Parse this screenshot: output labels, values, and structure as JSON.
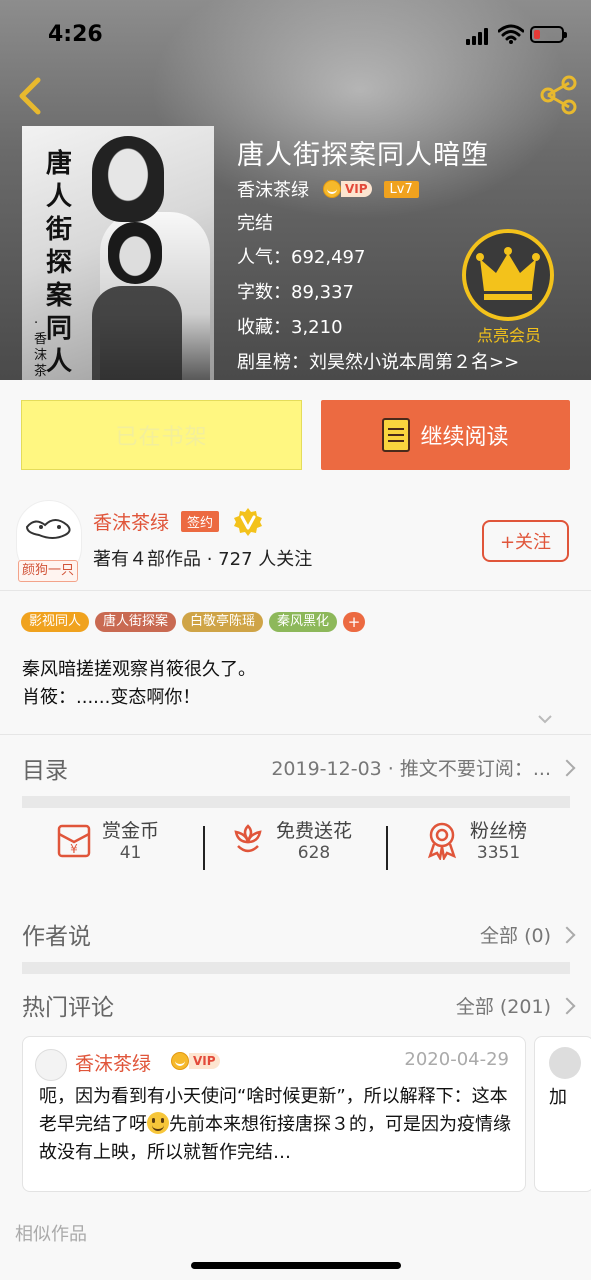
{
  "status_bar": {
    "time": "4:26"
  },
  "book": {
    "title": "唐人街探案同人暗堕",
    "author": "香沫茶绿",
    "vip": "VIP",
    "level": "Lv7",
    "status": "完结",
    "popularity": "人气：692,497",
    "words": "字数：89,337",
    "favorites": "收藏：3,210",
    "rank": "剧星榜：刘昊然小说本周第２名>>",
    "cover_title": "唐人街探案同人暗堕",
    "cover_author": "·香沫茶绿"
  },
  "member": {
    "label": "点亮会员"
  },
  "actions": {
    "shelf_label": "已在书架",
    "read_label": "继续阅读"
  },
  "author_card": {
    "name": "香沫茶绿",
    "sign_badge": "签约",
    "avatar_tag": "颜狗一只",
    "meta": "著有４部作品 · 727 人关注",
    "follow_label": "+关注"
  },
  "tags": [
    {
      "label": "影视同人",
      "color": "#f0a21e"
    },
    {
      "label": "唐人街探案",
      "color": "#c96a52"
    },
    {
      "label": "白敬亭陈瑶",
      "color": "#cfa447"
    },
    {
      "label": "秦风黑化",
      "color": "#8db85a"
    }
  ],
  "tag_more": "+",
  "summary": {
    "line1": "秦风暗搓搓观察肖筱很久了。",
    "line2": "肖筱：......变态啊你！"
  },
  "catalog": {
    "title": "目录",
    "right": "2019-12-03 · 推文不要订阅：..."
  },
  "stats": [
    {
      "label": "赏金币",
      "value": "41",
      "icon": "reward-coin-icon"
    },
    {
      "label": "免费送花",
      "value": "628",
      "icon": "flower-icon"
    },
    {
      "label": "粉丝榜",
      "value": "3351",
      "icon": "medal-icon"
    }
  ],
  "author_says": {
    "title": "作者说",
    "right": "全部 (0)"
  },
  "hot_comments": {
    "title": "热门评论",
    "right": "全部 (201)"
  },
  "comment": {
    "name": "香沫茶绿",
    "vip": "VIP",
    "date": "2020-04-29",
    "text_before_emoji": "呃，因为看到有小天使问“啥时候更新”，所以解释下：这本老早完结了呀",
    "text_after_emoji": "先前本来想衔接唐探３的，可是因为疫情缘故没有上映，所以就暂作完结…"
  },
  "comment2": {
    "text": "加"
  },
  "similar": {
    "title": "相似作品"
  },
  "colors": {
    "accent": "#ec6a41",
    "shelf_yellow": "#fff781",
    "crown_gold": "#f3c21b"
  }
}
